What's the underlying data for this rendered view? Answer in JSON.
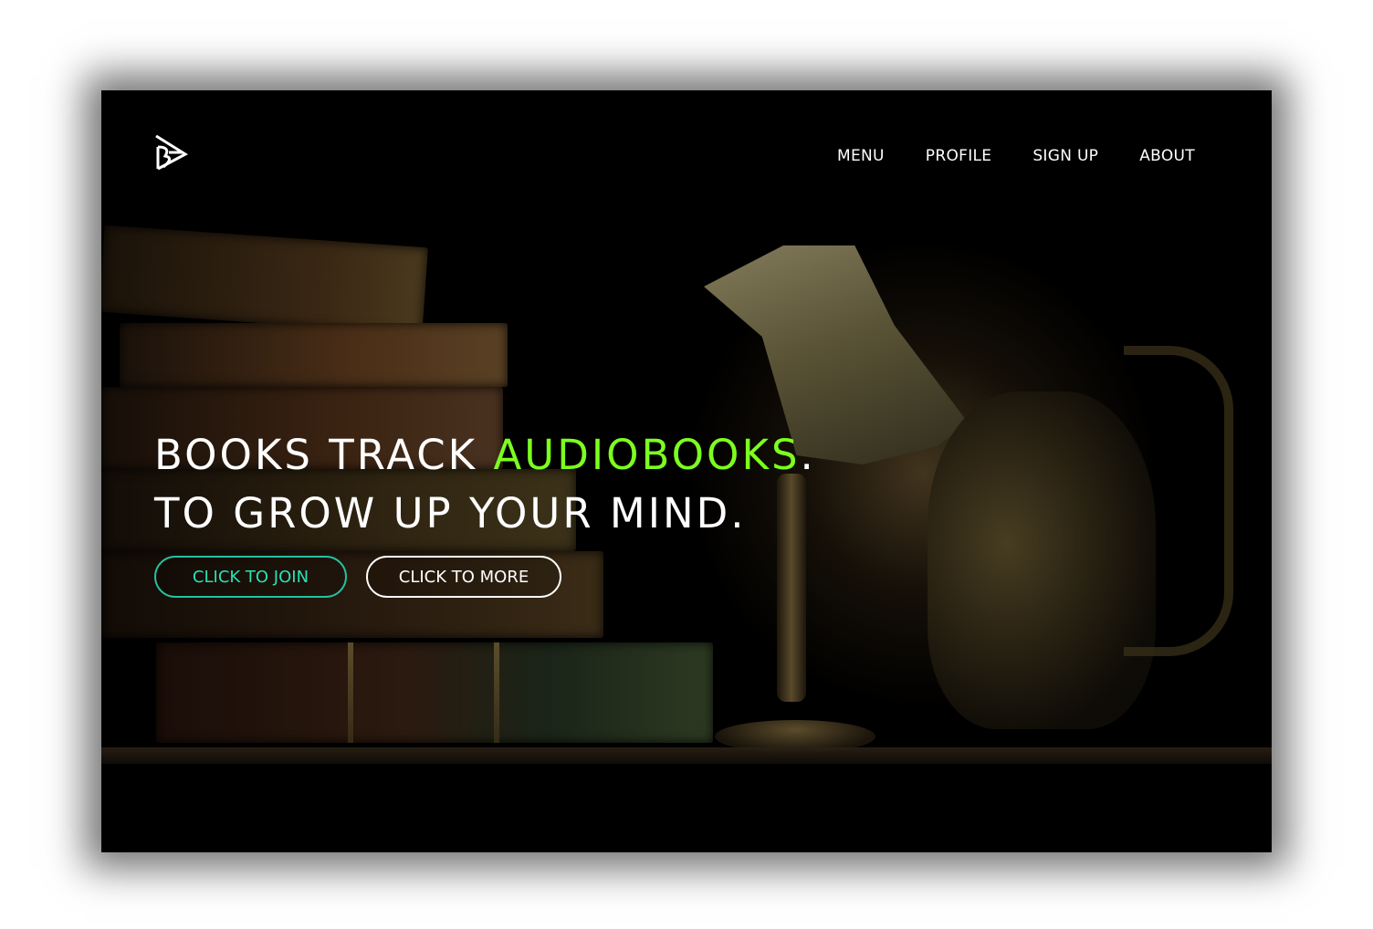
{
  "brand": {
    "logo_text": "B"
  },
  "nav": {
    "items": [
      "MENU",
      "PROFILE",
      "SIGN UP",
      "ABOUT"
    ]
  },
  "hero": {
    "line1_prefix": "BOOKS TRACK ",
    "line1_accent": "AUDIOBOOKS",
    "line1_suffix": ".",
    "line2": "TO GROW UP YOUR MIND.",
    "accent_color": "#7cff1f"
  },
  "buttons": {
    "join_label": "CLICK TO JOIN",
    "more_label": "CLICK TO MORE",
    "join_color": "#25c1a0"
  }
}
